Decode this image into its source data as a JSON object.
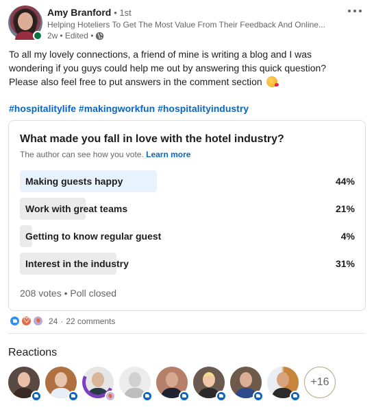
{
  "author": {
    "name": "Amy Branford",
    "degree": "• 1st",
    "headline": "Helping Hoteliers To Get The Most Value From Their Feedback And Online...",
    "time": "2w",
    "edited": "• Edited •",
    "visibility_icon": "globe-icon",
    "online": true,
    "online_color": "#057642"
  },
  "menu": {
    "more_icon": "ellipsis-icon"
  },
  "post": {
    "lines": [
      "To all my lovely connections, a friend of mine is writing a blog and I was",
      "wondering if you guys could help me out by answering this quick question?",
      "Please also feel free to put answers in the comment section"
    ],
    "emoji": "kissing-face-with-heart-emoji",
    "hashtags": [
      "#hospitalitylife",
      "#makingworkfun",
      "#hospitalityindustry"
    ]
  },
  "poll": {
    "question": "What made you fall in love with the hotel industry?",
    "note": "The author can see how you vote.",
    "learn_more": "Learn more",
    "options": [
      {
        "label": "Making guests happy",
        "percent": 44,
        "percent_label": "44%",
        "selected": true
      },
      {
        "label": "Work with great teams",
        "percent": 21,
        "percent_label": "21%",
        "selected": false
      },
      {
        "label": "Getting to know regular guest",
        "percent": 4,
        "percent_label": "4%",
        "selected": false
      },
      {
        "label": "Interest in the industry",
        "percent": 31,
        "percent_label": "31%",
        "selected": false
      }
    ],
    "footer": "208 votes • Poll closed"
  },
  "social": {
    "reaction_icons": [
      "like-icon",
      "love-icon",
      "support-icon"
    ],
    "reaction_count": "24",
    "separator": "·",
    "comments": "22 comments"
  },
  "reactions": {
    "title": "Reactions",
    "people": [
      {
        "reaction": "like"
      },
      {
        "reaction": "like"
      },
      {
        "reaction": "support",
        "hiring": true
      },
      {
        "reaction": "like"
      },
      {
        "reaction": "like"
      },
      {
        "reaction": "like"
      },
      {
        "reaction": "like"
      },
      {
        "reaction": "like"
      }
    ],
    "more_label": "+16"
  },
  "colors": {
    "link": "#0a66c2",
    "selected_bar": "#e8f2fd",
    "bar": "#ebebeb"
  }
}
